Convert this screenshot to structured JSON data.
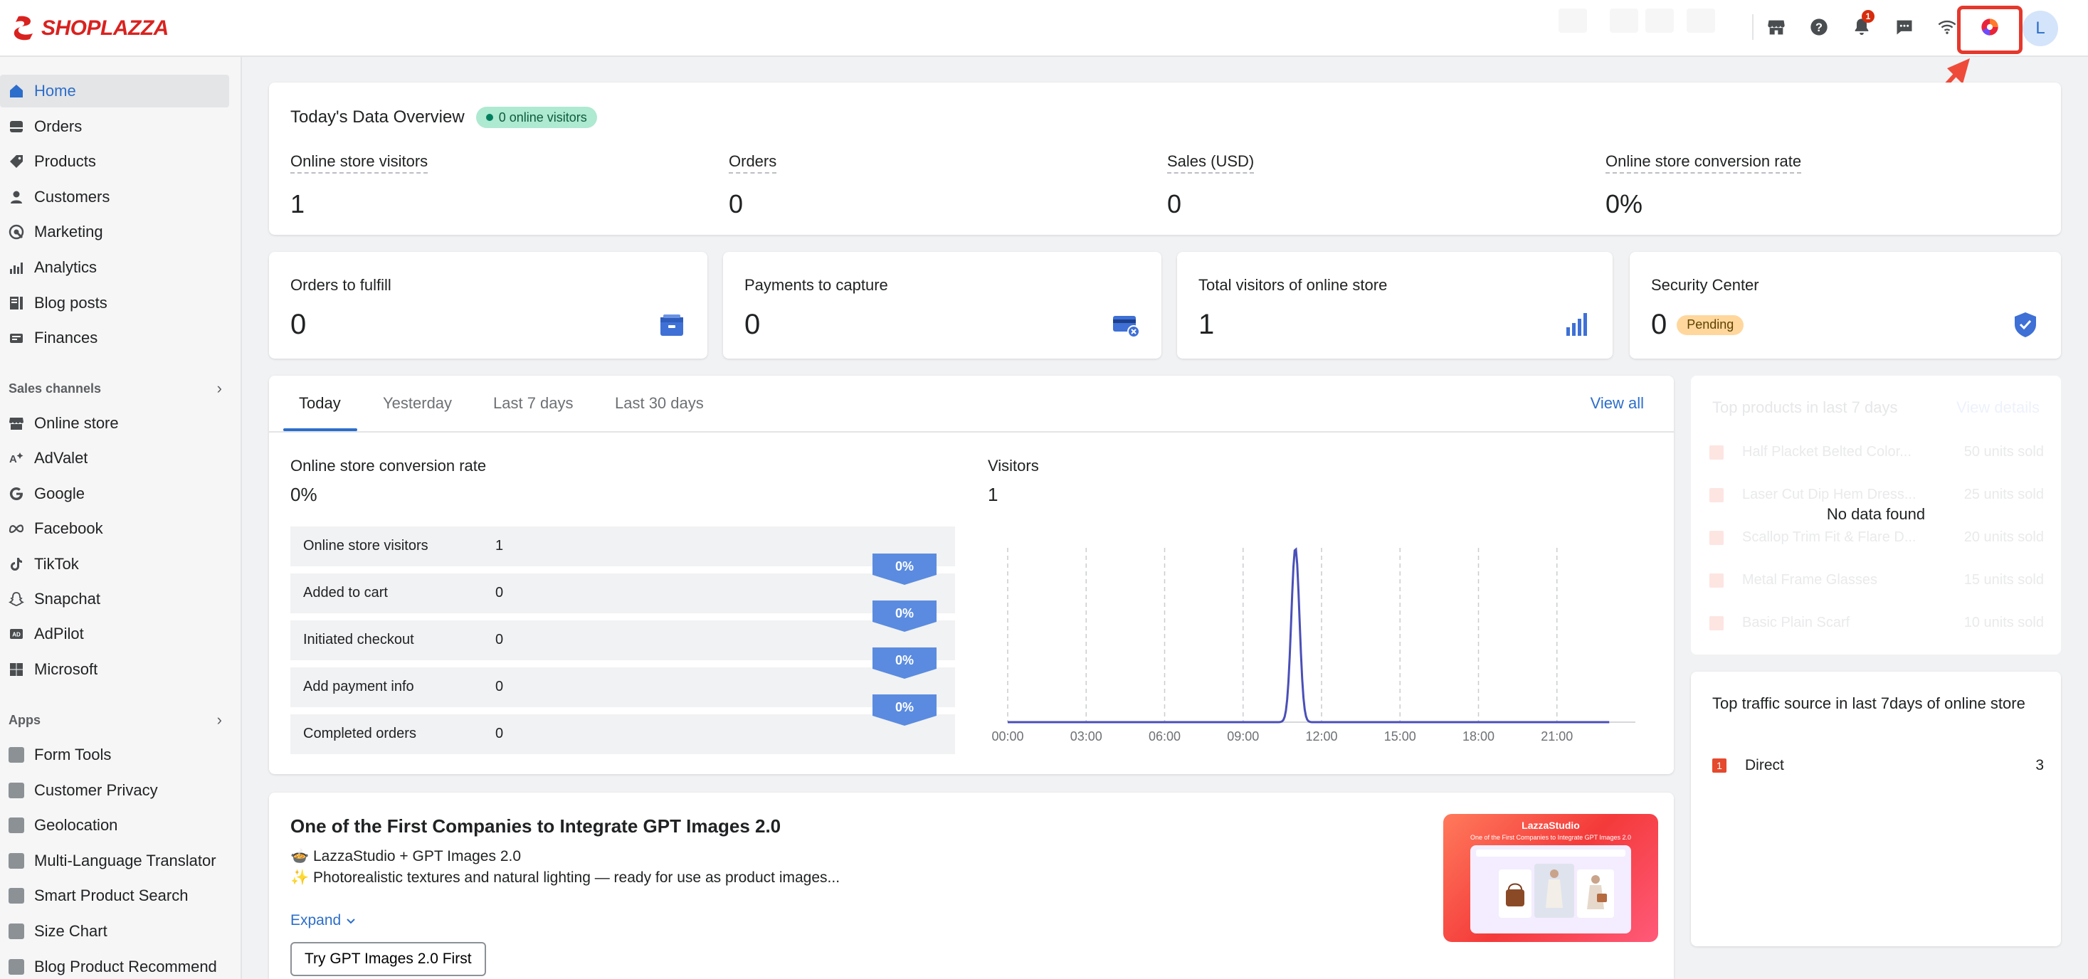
{
  "topbar": {
    "brand": "SHOPLAZZA",
    "notification_count": "1",
    "avatar_initial": "L"
  },
  "sidebar": {
    "main_items": [
      {
        "label": "Home",
        "icon": "home-icon"
      },
      {
        "label": "Orders",
        "icon": "orders-icon"
      },
      {
        "label": "Products",
        "icon": "tag-icon"
      },
      {
        "label": "Customers",
        "icon": "person-icon"
      },
      {
        "label": "Marketing",
        "icon": "marketing-icon"
      },
      {
        "label": "Analytics",
        "icon": "bar-chart-icon"
      },
      {
        "label": "Blog posts",
        "icon": "blog-icon"
      },
      {
        "label": "Finances",
        "icon": "finances-icon"
      }
    ],
    "sales_channels_title": "Sales channels",
    "sales_channels": [
      {
        "label": "Online store",
        "icon": "store-icon"
      },
      {
        "label": "AdValet",
        "icon": "advalet-icon"
      },
      {
        "label": "Google",
        "icon": "google-icon"
      },
      {
        "label": "Facebook",
        "icon": "meta-icon"
      },
      {
        "label": "TikTok",
        "icon": "tiktok-icon"
      },
      {
        "label": "Snapchat",
        "icon": "snapchat-icon"
      },
      {
        "label": "AdPilot",
        "icon": "adpilot-icon"
      },
      {
        "label": "Microsoft",
        "icon": "microsoft-icon"
      }
    ],
    "apps_title": "Apps",
    "apps": [
      {
        "label": "Form Tools"
      },
      {
        "label": "Customer Privacy"
      },
      {
        "label": "Geolocation"
      },
      {
        "label": "Multi-Language Translator"
      },
      {
        "label": "Smart Product Search"
      },
      {
        "label": "Size Chart"
      },
      {
        "label": "Blog Product Recommend"
      }
    ]
  },
  "overview": {
    "title": "Today's Data Overview",
    "online_badge": "0 online visitors",
    "metrics": [
      {
        "label": "Online store visitors",
        "value": "1"
      },
      {
        "label": "Orders",
        "value": "0"
      },
      {
        "label": "Sales (USD)",
        "value": "0"
      },
      {
        "label": "Online store conversion rate",
        "value": "0%"
      }
    ]
  },
  "stats": [
    {
      "label": "Orders to fulfill",
      "value": "0",
      "icon": "box-icon"
    },
    {
      "label": "Payments to capture",
      "value": "0",
      "icon": "card-icon"
    },
    {
      "label": "Total visitors of online store",
      "value": "1",
      "icon": "bar-chart-icon"
    },
    {
      "label": "Security Center",
      "value": "0",
      "badge": "Pending",
      "icon": "shield-icon"
    }
  ],
  "analytics": {
    "tabs": [
      "Today",
      "Yesterday",
      "Last 7 days",
      "Last 30 days"
    ],
    "view_all": "View all",
    "conversion_title": "Online store conversion rate",
    "conversion_value": "0%",
    "funnel": [
      {
        "label": "Online store visitors",
        "value": "1"
      },
      {
        "label": "Added to cart",
        "value": "0"
      },
      {
        "label": "Initiated checkout",
        "value": "0"
      },
      {
        "label": "Add payment info",
        "value": "0"
      },
      {
        "label": "Completed orders",
        "value": "0"
      }
    ],
    "funnel_rates": [
      "0%",
      "0%",
      "0%",
      "0%"
    ],
    "visitors_title": "Visitors",
    "visitors_value": "1"
  },
  "chart_data": {
    "type": "line",
    "x": [
      "00:00",
      "01:00",
      "02:00",
      "03:00",
      "04:00",
      "05:00",
      "06:00",
      "07:00",
      "08:00",
      "09:00",
      "10:00",
      "11:00",
      "12:00",
      "13:00",
      "14:00",
      "15:00",
      "16:00",
      "17:00",
      "18:00",
      "19:00",
      "20:00",
      "21:00",
      "22:00",
      "23:00"
    ],
    "series": [
      {
        "values": [
          0,
          0,
          0,
          0,
          0,
          0,
          0,
          0,
          0,
          0,
          0,
          1,
          0,
          0,
          0,
          0,
          0,
          0,
          0,
          0,
          0,
          0,
          0,
          0
        ]
      }
    ],
    "tick_labels": [
      "00:00",
      "03:00",
      "06:00",
      "09:00",
      "12:00",
      "15:00",
      "18:00",
      "21:00"
    ],
    "ylim": [
      0,
      1
    ],
    "line_color": "#4a4fb8",
    "grid": "vertical dashed"
  },
  "top_products": {
    "title": "Top products in last 7 days",
    "view_details": "View details",
    "empty": "No data found",
    "items": [
      {
        "rank": "1",
        "name": "Half Placket Belted Color...",
        "units": "50 units sold"
      },
      {
        "rank": "2",
        "name": "Laser Cut Dip Hem Dress...",
        "units": "25 units sold"
      },
      {
        "rank": "3",
        "name": "Scallop Trim Fit & Flare D...",
        "units": "20 units sold"
      },
      {
        "rank": "4",
        "name": "Metal Frame Glasses",
        "units": "15 units sold"
      },
      {
        "rank": "5",
        "name": "Basic Plain Scarf",
        "units": "10 units sold"
      }
    ]
  },
  "traffic": {
    "title": "Top traffic source in last 7days of online store",
    "items": [
      {
        "rank": "1",
        "source": "Direct",
        "count": "3"
      }
    ]
  },
  "banner": {
    "title": "One of the First Companies to Integrate GPT Images 2.0",
    "line1": "🍲 LazzaStudio + GPT Images 2.0",
    "line2": "✨ Photorealistic textures and natural lighting — ready for use as product images...",
    "expand": "Expand",
    "button": "Try GPT Images 2.0 First",
    "image_brand": "LazzaStudio",
    "image_caption": "One of the First Companies to Integrate GPT Images 2.0"
  },
  "colors": {
    "accent": "#2c6ecb",
    "brand": "#d9221f",
    "chart_line": "#4a4fb8",
    "funnel_tag": "#5a8be0"
  }
}
